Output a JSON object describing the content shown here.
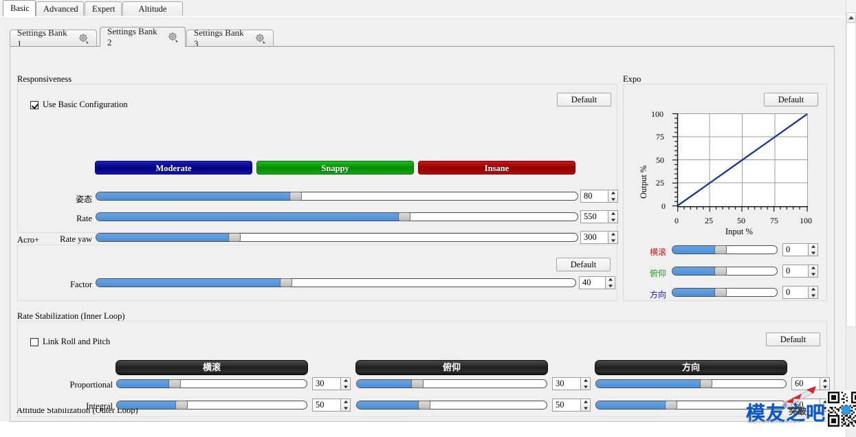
{
  "window": {
    "top_tabs": [
      {
        "label": "Basic",
        "active": true
      },
      {
        "label": "Advanced",
        "active": false
      },
      {
        "label": "Expert",
        "active": false
      },
      {
        "label": "Altitude Hold",
        "active": false
      }
    ],
    "bank_tabs": [
      {
        "label": "Settings Bank 1",
        "icon": "gear-icon",
        "active": false
      },
      {
        "label": "Settings Bank 2",
        "icon": "gear-icon",
        "active": true
      },
      {
        "label": "Settings Bank 3",
        "icon": "gear-icon",
        "active": false
      }
    ],
    "clipped_group_title": "Attitude Stabilization (Outer Loop)"
  },
  "responsiveness": {
    "title": "Responsiveness",
    "default_label": "Default",
    "use_basic_config": {
      "label": "Use Basic Configuration",
      "checked": true
    },
    "mode_buttons": [
      {
        "label": "Moderate",
        "color": "#00007c"
      },
      {
        "label": "Snappy",
        "color": "#008c00"
      },
      {
        "label": "Insane",
        "color": "#910000"
      }
    ],
    "sliders": [
      {
        "label": "姿态",
        "value": "80",
        "fill_pct": 41.5
      },
      {
        "label": "Rate",
        "value": "550",
        "fill_pct": 64.0
      },
      {
        "label": "Rate yaw",
        "value": "300",
        "fill_pct": 28.8
      }
    ]
  },
  "acro": {
    "title": "Acro+",
    "default_label": "Default",
    "sliders": [
      {
        "label": "Factor",
        "value": "40",
        "fill_pct": 39.6
      }
    ]
  },
  "expo": {
    "title": "Expo",
    "default_label": "Default",
    "sliders": [
      {
        "label": "横滚",
        "value": "0",
        "fill_pct": 46.0,
        "color": "#d61414"
      },
      {
        "label": "俯仰",
        "value": "0",
        "fill_pct": 46.0,
        "color": "#109c10"
      },
      {
        "label": "方向",
        "value": "0",
        "fill_pct": 46.0,
        "color": "#1414c8"
      }
    ],
    "chart_data": {
      "type": "line",
      "title": "",
      "xlabel": "Input %",
      "ylabel": "Output %",
      "xlim": [
        0,
        100
      ],
      "ylim": [
        0,
        100
      ],
      "xticks": [
        "0",
        "25",
        "50",
        "75",
        "100"
      ],
      "yticks": [
        "0",
        "25",
        "50",
        "75",
        "100"
      ],
      "grid": true,
      "legend": "none",
      "line_color": "#1f3a93",
      "series": [
        {
          "name": "expo curve",
          "x": [
            0,
            25,
            50,
            75,
            100
          ],
          "y": [
            0,
            25,
            50,
            75,
            100
          ]
        }
      ]
    }
  },
  "rate_stabilization": {
    "title": "Rate Stabilization (Inner Loop)",
    "default_label": "Default",
    "link_roll_pitch": {
      "label": "Link Roll and Pitch",
      "checked": false
    },
    "axis_headers": [
      "横滚",
      "俯仰",
      "方向"
    ],
    "row_labels": [
      "Proportional",
      "Integral"
    ],
    "rows": [
      {
        "label": "Proportional",
        "cells": [
          {
            "value": "30",
            "fill_pct": 30.5
          },
          {
            "value": "30",
            "fill_pct": 32.0
          },
          {
            "value": "60",
            "fill_pct": 58.0
          }
        ]
      },
      {
        "label": "Integral",
        "cells": [
          {
            "value": "50",
            "fill_pct": 34.0
          },
          {
            "value": "50",
            "fill_pct": 35.5
          },
          {
            "value": "60",
            "fill_pct": 39.5
          }
        ]
      }
    ]
  },
  "scrollbar": {
    "up_arrow": "scroll-up-arrow"
  },
  "watermark": {
    "text": "模友之吧",
    "url": "http://www.moz8.com",
    "overlay": "突破"
  }
}
